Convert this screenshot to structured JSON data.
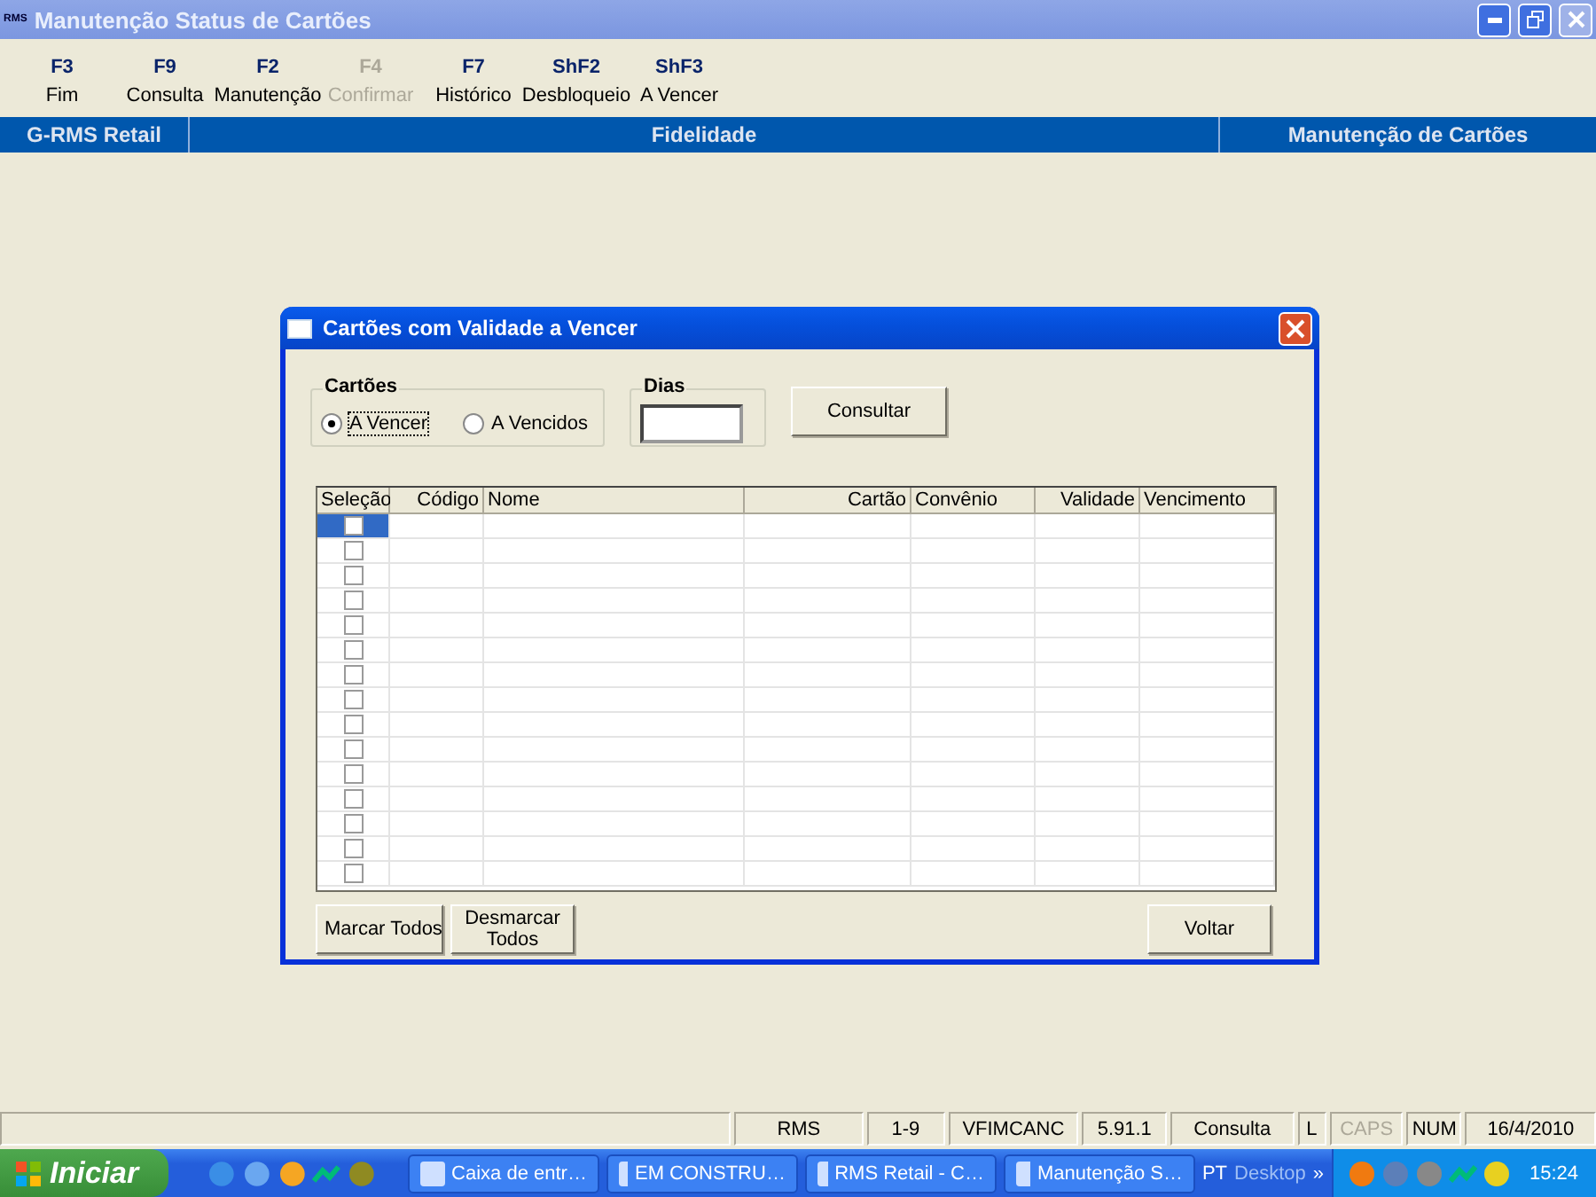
{
  "window": {
    "title": "Manutenção Status de Cartões",
    "logo": "RMS"
  },
  "toolbar": [
    {
      "key": "F3",
      "label": "Fim",
      "disabled": false
    },
    {
      "key": "F9",
      "label": "Consulta",
      "disabled": false
    },
    {
      "key": "F2",
      "label": "Manutenção",
      "disabled": false
    },
    {
      "key": "F4",
      "label": "Confirmar",
      "disabled": true
    },
    {
      "key": "F7",
      "label": "Histórico",
      "disabled": false
    },
    {
      "key": "ShF2",
      "label": "Desbloqueio",
      "disabled": false
    },
    {
      "key": "ShF3",
      "label": "A Vencer",
      "disabled": false
    }
  ],
  "band": [
    "G-RMS Retail",
    "Fidelidade",
    "Manutenção de Cartões"
  ],
  "dialog": {
    "title": "Cartões com Validade a Vencer",
    "group_label": "Cartões",
    "radios": [
      {
        "label": "A Vencer",
        "selected": true
      },
      {
        "label": "A Vencidos",
        "selected": false
      }
    ],
    "days_label": "Dias",
    "query_button": "Consultar",
    "columns": [
      "Seleção",
      "Código",
      "Nome",
      "Cartão",
      "Convênio",
      "Validade",
      "Vencimento"
    ],
    "rows": [
      {
        "checked": false,
        "selected": true
      },
      {
        "checked": false,
        "selected": false
      },
      {
        "checked": false,
        "selected": false
      },
      {
        "checked": false,
        "selected": false
      },
      {
        "checked": false,
        "selected": false
      },
      {
        "checked": false,
        "selected": false
      },
      {
        "checked": false,
        "selected": false
      },
      {
        "checked": false,
        "selected": false
      },
      {
        "checked": false,
        "selected": false
      },
      {
        "checked": false,
        "selected": false
      },
      {
        "checked": false,
        "selected": false
      },
      {
        "checked": false,
        "selected": false
      },
      {
        "checked": false,
        "selected": false
      },
      {
        "checked": false,
        "selected": false
      },
      {
        "checked": false,
        "selected": false
      }
    ],
    "buttons_left": [
      "Marcar Todos",
      "Desmarcar Todos"
    ],
    "button_right": "Voltar"
  },
  "status_bar": [
    {
      "text": "RMS",
      "disabled": false
    },
    {
      "text": "1-9",
      "disabled": false
    },
    {
      "text": "VFIMCANC",
      "disabled": false
    },
    {
      "text": "5.91.1",
      "disabled": false
    },
    {
      "text": "Consulta",
      "disabled": false
    },
    {
      "text": "L",
      "disabled": false
    },
    {
      "text": "CAPS",
      "disabled": true
    },
    {
      "text": "NUM",
      "disabled": false
    },
    {
      "text": "16/4/2010",
      "disabled": false
    }
  ],
  "taskbar": {
    "start": "Iniciar",
    "tasks": [
      {
        "label": "Caixa de entr…",
        "selected": false
      },
      {
        "label": "EM CONSTRU…",
        "selected": false
      },
      {
        "label": "RMS Retail - C…",
        "selected": false
      },
      {
        "label": "Manutenção S…",
        "selected": false
      }
    ],
    "language": "PT",
    "desktop": "Desktop",
    "more": "»",
    "clock": "15:24"
  }
}
